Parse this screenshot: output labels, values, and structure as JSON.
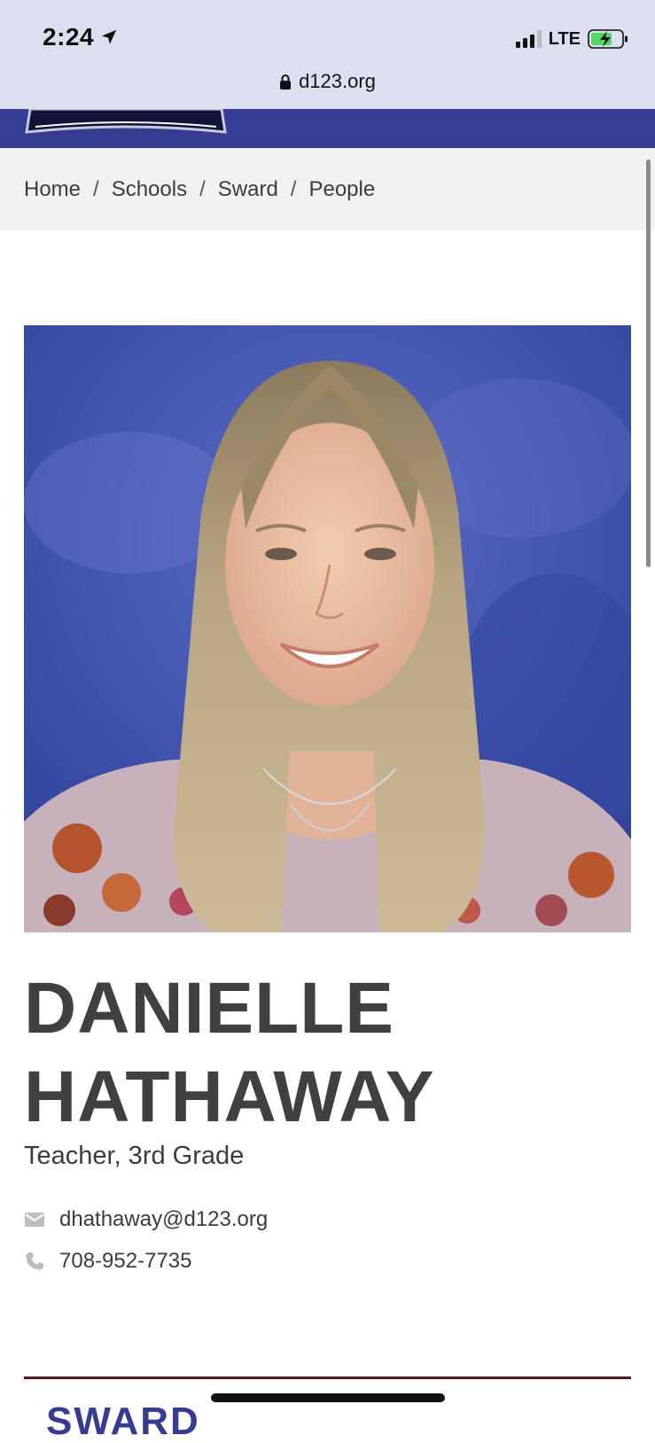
{
  "status_bar": {
    "time": "2:24",
    "network": "LTE",
    "location_icon": "location-arrow-icon",
    "signal_icon": "signal-bars-icon",
    "battery_icon": "battery-charging-icon",
    "battery_color": "#4cd964"
  },
  "browser": {
    "url": "d123.org",
    "lock_icon": "lock-icon"
  },
  "site": {
    "header_color": "#353c92"
  },
  "breadcrumb": {
    "items": [
      "Home",
      "Schools",
      "Sward",
      "People"
    ],
    "separator": "/"
  },
  "person": {
    "name_line1": "DANIELLE",
    "name_line2": "HATHAWAY",
    "title": "Teacher, 3rd Grade",
    "email": "dhathaway@d123.org",
    "phone": "708-952-7735",
    "email_icon": "envelope-icon",
    "phone_icon": "phone-icon"
  },
  "footer": {
    "heading": "SWARD",
    "divider_color": "#5a1818"
  }
}
